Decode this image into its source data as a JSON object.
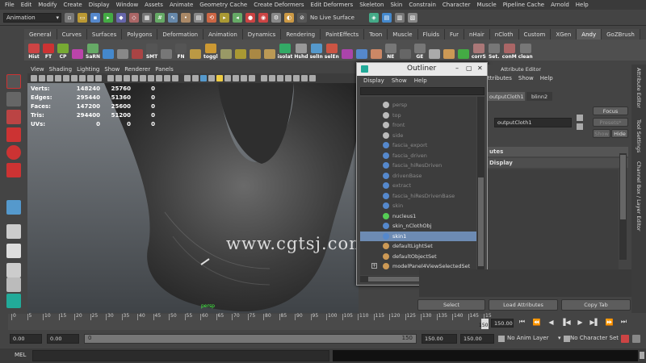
{
  "menubar": [
    "File",
    "Edit",
    "Modify",
    "Create",
    "Display",
    "Window",
    "Assets",
    "Animate",
    "Geometry Cache",
    "Create Deformers",
    "Edit Deformers",
    "Skeleton",
    "Skin",
    "Constrain",
    "Character",
    "Muscle",
    "Pipeline Cache",
    "Arnold",
    "Help"
  ],
  "statusline": {
    "mode": "Animation",
    "live_surface": "No Live Surface"
  },
  "shelf_tabs": [
    "General",
    "Curves",
    "Surfaces",
    "Polygons",
    "Deformation",
    "Animation",
    "Dynamics",
    "Rendering",
    "PaintEffects",
    "Toon",
    "Muscle",
    "Fluids",
    "Fur",
    "nHair",
    "nCloth",
    "Custom",
    "XGen",
    "Andy",
    "GoZBrush"
  ],
  "shelf_active": "Andy",
  "shelf_items": [
    {
      "label": "Hist",
      "color": "#c44"
    },
    {
      "label": "FT",
      "color": "#c33"
    },
    {
      "label": "CP",
      "color": "#7a3"
    },
    {
      "label": "",
      "color": "#b4a"
    },
    {
      "label": "SaRN",
      "color": "#6a6"
    },
    {
      "label": "",
      "color": "#48c"
    },
    {
      "label": "",
      "color": "#888"
    },
    {
      "label": "",
      "color": "#a44"
    },
    {
      "label": "SMT",
      "color": "#555"
    },
    {
      "label": "",
      "color": "#777"
    },
    {
      "label": "FN",
      "color": "#555"
    },
    {
      "label": "",
      "color": "#b94"
    },
    {
      "label": "toggl",
      "color": "#c93"
    },
    {
      "label": "",
      "color": "#996"
    },
    {
      "label": "",
      "color": "#a93"
    },
    {
      "label": "",
      "color": "#a84"
    },
    {
      "label": "",
      "color": "#b95"
    },
    {
      "label": "isolat",
      "color": "#3a6"
    },
    {
      "label": "Hshd",
      "color": "#999"
    },
    {
      "label": "selIn",
      "color": "#59c"
    },
    {
      "label": "selEn",
      "color": "#c54"
    },
    {
      "label": "",
      "color": "#a4a"
    },
    {
      "label": "",
      "color": "#58c"
    },
    {
      "label": "",
      "color": "#c86"
    },
    {
      "label": "NE",
      "color": "#777"
    },
    {
      "label": "",
      "color": "#666"
    },
    {
      "label": "GE",
      "color": "#777"
    },
    {
      "label": "",
      "color": "#aaa"
    },
    {
      "label": "",
      "color": "#c95"
    },
    {
      "label": "",
      "color": "#4a4"
    },
    {
      "label": "corrS",
      "color": "#a77"
    },
    {
      "label": "Set.",
      "color": "#777"
    },
    {
      "label": "conM",
      "color": "#a66"
    },
    {
      "label": "clean",
      "color": "#777"
    }
  ],
  "viewport": {
    "menu": [
      "View",
      "Shading",
      "Lighting",
      "Show",
      "Renderer",
      "Panels"
    ],
    "camera": "persp",
    "hud": [
      {
        "label": "Verts:",
        "v1": "148240",
        "v2": "25760",
        "v3": "0"
      },
      {
        "label": "Edges:",
        "v1": "295440",
        "v2": "51360",
        "v3": "0"
      },
      {
        "label": "Faces:",
        "v1": "147200",
        "v2": "25600",
        "v3": "0"
      },
      {
        "label": "Tris:",
        "v1": "294400",
        "v2": "51200",
        "v3": "0"
      },
      {
        "label": "UVs:",
        "v1": "0",
        "v2": "0",
        "v3": "0"
      }
    ],
    "watermark": "www.cgtsj.com"
  },
  "outliner": {
    "title": "Outliner",
    "menu": [
      "Display",
      "Show",
      "Help"
    ],
    "items": [
      {
        "name": "persp",
        "dim": true,
        "color": "#bbb"
      },
      {
        "name": "top",
        "dim": true,
        "color": "#bbb"
      },
      {
        "name": "front",
        "dim": true,
        "color": "#bbb"
      },
      {
        "name": "side",
        "dim": true,
        "color": "#bbb"
      },
      {
        "name": "fascia_export",
        "dim": true,
        "color": "#58c"
      },
      {
        "name": "fascia_driven",
        "dim": true,
        "color": "#58c"
      },
      {
        "name": "fascia_hiResDriven",
        "dim": true,
        "color": "#58c"
      },
      {
        "name": "drivenBase",
        "dim": true,
        "color": "#58c"
      },
      {
        "name": "extract",
        "dim": true,
        "color": "#58c"
      },
      {
        "name": "fascia_hiResDrivenBase",
        "dim": true,
        "color": "#58c"
      },
      {
        "name": "skin",
        "dim": true,
        "color": "#58c"
      },
      {
        "name": "nucleus1",
        "dim": false,
        "color": "#5c5"
      },
      {
        "name": "skin_nClothObj",
        "dim": false,
        "color": "#58c"
      },
      {
        "name": "skin1",
        "dim": false,
        "sel": true,
        "color": "#58c"
      },
      {
        "name": "defaultLightSet",
        "dim": false,
        "color": "#c95"
      },
      {
        "name": "defaultObjectSet",
        "dim": false,
        "color": "#c95"
      },
      {
        "name": "modelPanel4ViewSelectedSet",
        "dim": false,
        "color": "#c95"
      }
    ]
  },
  "attr": {
    "title": "Attribute Editor",
    "menu_tail": "ttributes",
    "menu": [
      "Show",
      "Help"
    ],
    "tabs": [
      "outputCloth1",
      "blinn2"
    ],
    "node_field": "outputCloth1",
    "focus": "Focus",
    "presets": "Presets*",
    "show": "Show",
    "hide": "Hide",
    "section1": "utes",
    "section2": "Display",
    "side_tabs": [
      "Attribute Editor",
      "Tool Settings",
      "Channel Box / Layer Editor"
    ],
    "buttons": {
      "select": "Select",
      "load": "Load Attributes",
      "copy": "Copy Tab"
    }
  },
  "timeline": {
    "ticks": [
      "0",
      "5",
      "10",
      "15",
      "20",
      "25",
      "30",
      "35",
      "40",
      "45",
      "50",
      "55",
      "60",
      "65",
      "70",
      "75",
      "80",
      "85",
      "90",
      "95",
      "100",
      "105",
      "110",
      "115",
      "120",
      "125",
      "130",
      "135",
      "140",
      "145",
      "15"
    ],
    "current_frame": "150",
    "current_field": "150.00"
  },
  "range": {
    "start": "0.00",
    "start2": "0.00",
    "slider_start": "0",
    "slider_end": "150",
    "end1": "150.00",
    "end2": "150.00",
    "anim_layer": "No Anim Layer",
    "character_set": "No Character Set"
  },
  "cmd": {
    "label": "MEL"
  }
}
